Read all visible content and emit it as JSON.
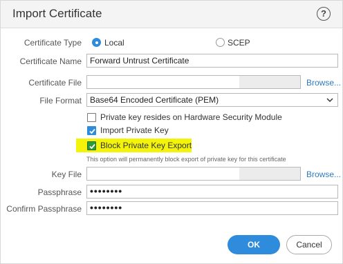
{
  "dialog": {
    "title": "Import Certificate",
    "help_icon": "?"
  },
  "form": {
    "certificate_type": {
      "label": "Certificate Type",
      "options": [
        "Local",
        "SCEP"
      ],
      "selected": "Local"
    },
    "certificate_name": {
      "label": "Certificate Name",
      "value": "Forward Untrust Certificate"
    },
    "certificate_file": {
      "label": "Certificate File",
      "browse": "Browse..."
    },
    "file_format": {
      "label": "File Format",
      "value": "Base64 Encoded Certificate (PEM)"
    },
    "checkboxes": [
      {
        "label": "Private key resides on Hardware Security Module",
        "checked": false
      },
      {
        "label": "Import Private Key",
        "checked": true
      },
      {
        "label": "Block Private Key Export",
        "checked": true
      }
    ],
    "note": "This option will permanently block export of private key for this certificate",
    "key_file": {
      "label": "Key File",
      "browse": "Browse..."
    },
    "passphrase": {
      "label": "Passphrase",
      "value": "••••••••"
    },
    "confirm_passphrase": {
      "label": "Confirm Passphrase",
      "value": "••••••••"
    }
  },
  "buttons": {
    "ok": "OK",
    "cancel": "Cancel"
  },
  "colors": {
    "accent": "#2f8bdc",
    "link": "#2d7ac0",
    "highlight": "#f4f40a"
  }
}
